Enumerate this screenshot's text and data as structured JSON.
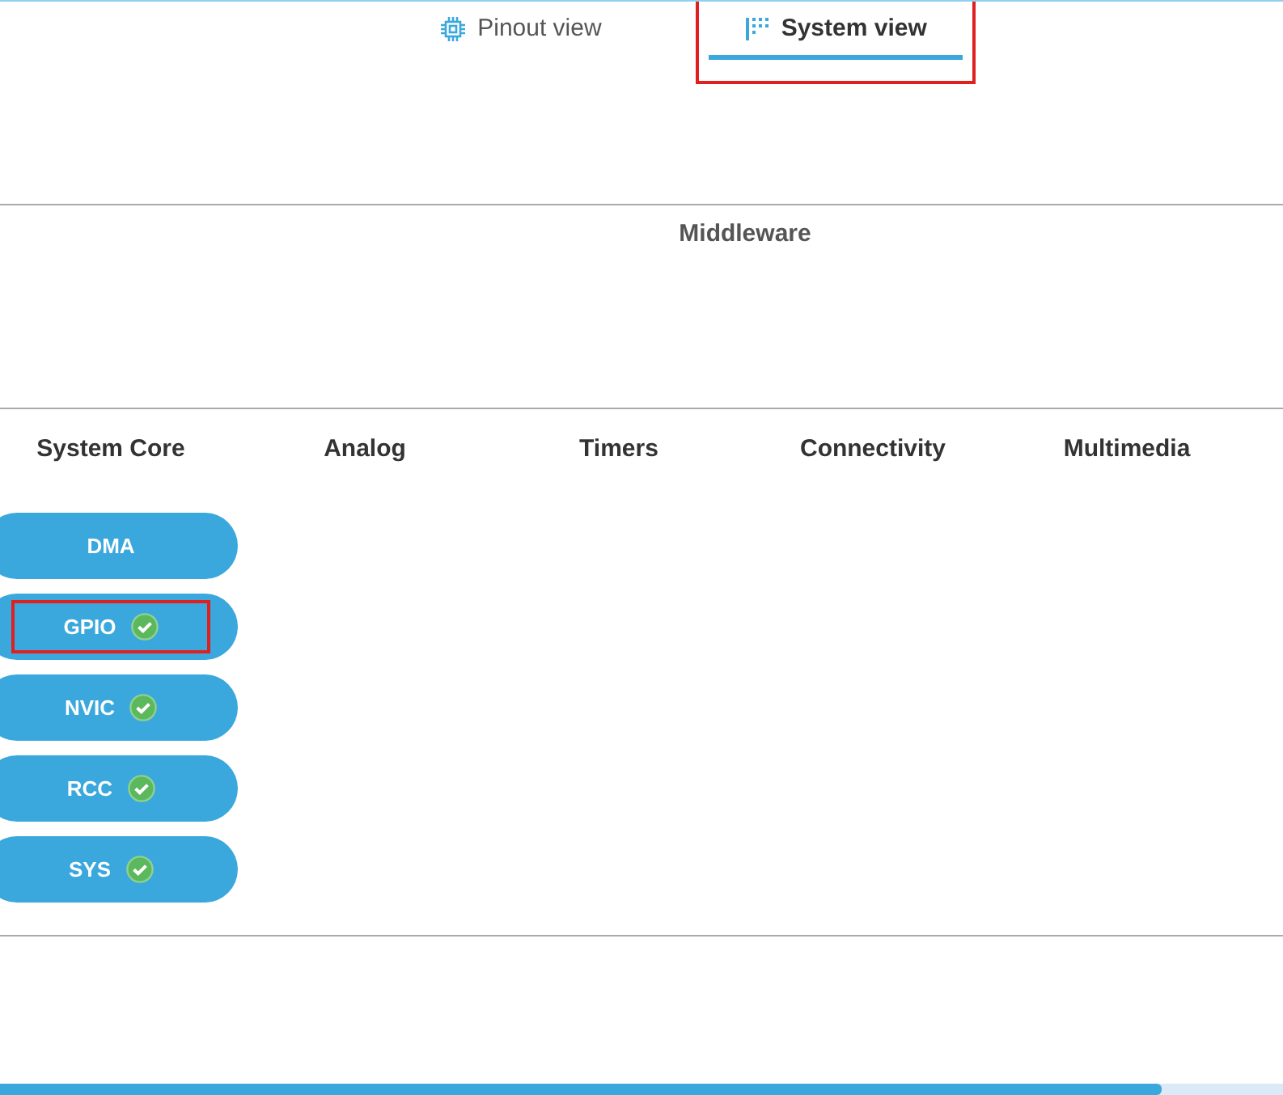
{
  "tabs": [
    {
      "label": "Pinout view",
      "kind": "chip",
      "selected": false,
      "highlighted": false
    },
    {
      "label": "System view",
      "kind": "bars",
      "selected": true,
      "highlighted": true
    }
  ],
  "middleware": {
    "title": "Middleware"
  },
  "categories": [
    {
      "title": "System Core",
      "items": [
        {
          "label": "DMA",
          "configured": false,
          "highlighted": false
        },
        {
          "label": "GPIO",
          "configured": true,
          "highlighted": true
        },
        {
          "label": "NVIC",
          "configured": true,
          "highlighted": false
        },
        {
          "label": "RCC",
          "configured": true,
          "highlighted": false
        },
        {
          "label": "SYS",
          "configured": true,
          "highlighted": false
        }
      ]
    },
    {
      "title": "Analog"
    },
    {
      "title": "Timers"
    },
    {
      "title": "Connectivity"
    },
    {
      "title": "Multimedia"
    }
  ]
}
